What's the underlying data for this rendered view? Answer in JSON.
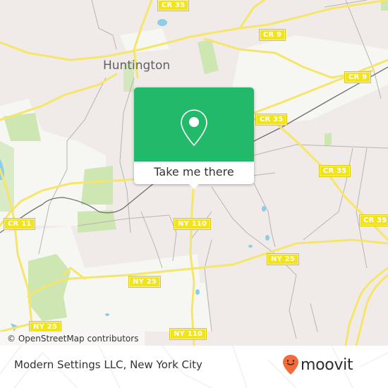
{
  "map": {
    "place_labels": [
      {
        "name": "Huntington"
      }
    ],
    "road_shields": [
      {
        "label": "CR 35"
      },
      {
        "label": "CR 9"
      },
      {
        "label": "CR 9"
      },
      {
        "label": "CR 35"
      },
      {
        "label": "CR 35"
      },
      {
        "label": "CR 35"
      },
      {
        "label": "NY 110"
      },
      {
        "label": "CR 11"
      },
      {
        "label": "NY 25"
      },
      {
        "label": "NY 25"
      },
      {
        "label": "NY 25"
      },
      {
        "label": "NY 110"
      }
    ],
    "attribution": "© OpenStreetMap contributors",
    "colors": {
      "land": "#f0ebe8",
      "park": "#cde6b2",
      "residential_light": "#f6f6f3",
      "major_road": "#f5e66b",
      "water": "#8ecde8",
      "rail": "#707070"
    }
  },
  "popup": {
    "icon": "map-pin-icon",
    "button_label": "Take me there",
    "accent_color": "#22b96a"
  },
  "footer": {
    "title": "Modern Settings LLC, New York City",
    "brand": "moovit",
    "brand_icon": "moovit-smiley-pin-icon",
    "brand_color": "#f26b3a"
  }
}
